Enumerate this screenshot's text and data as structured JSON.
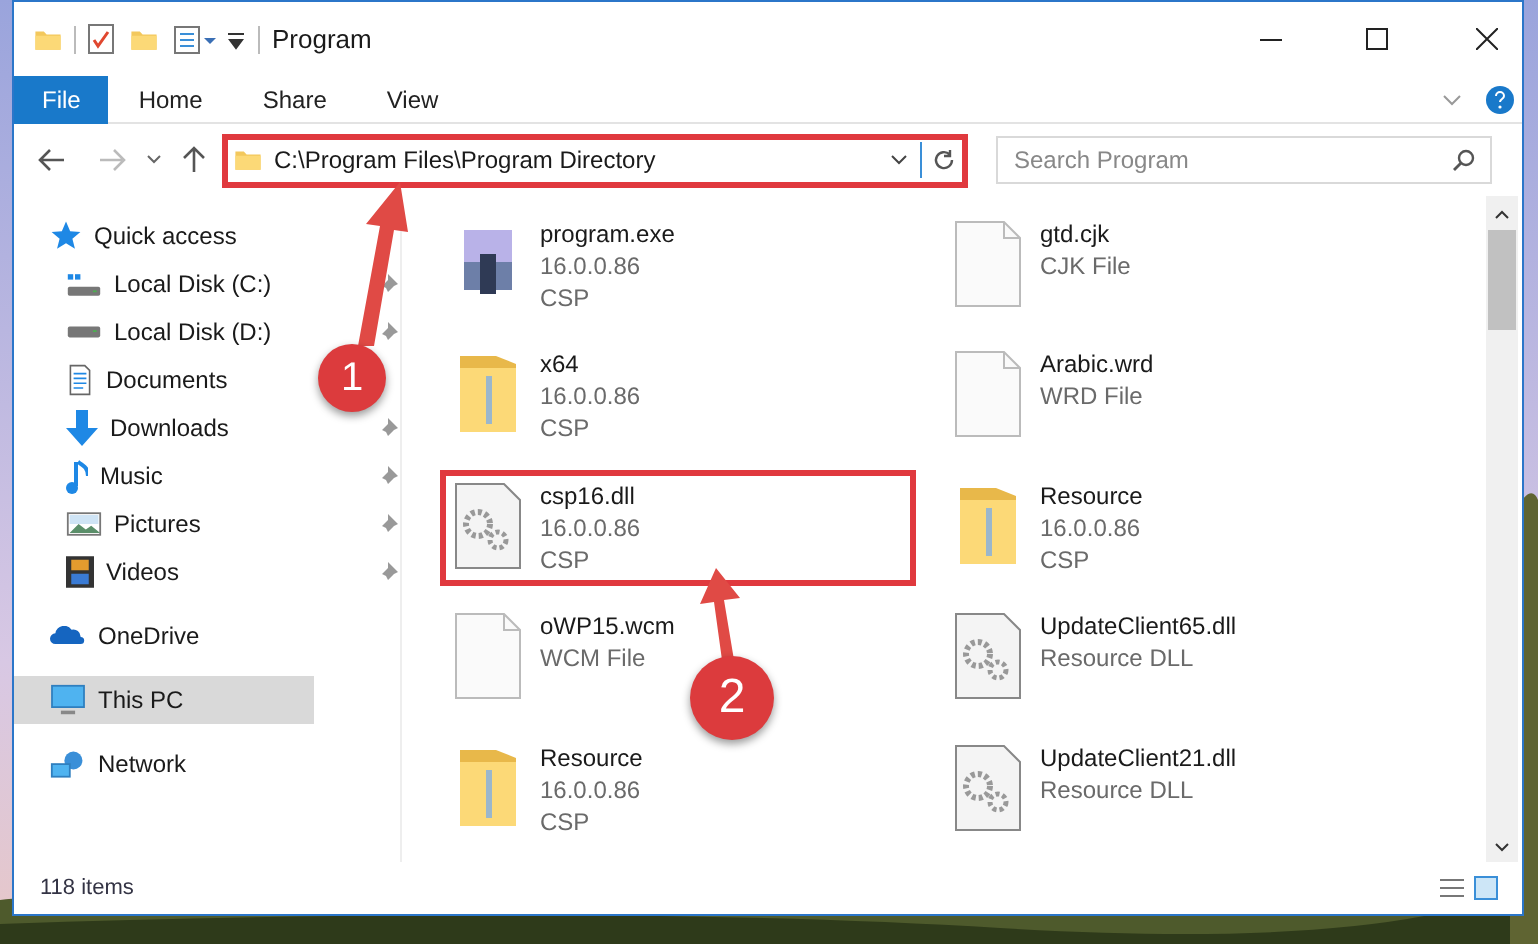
{
  "window": {
    "title": "Program"
  },
  "ribbon_tabs": [
    {
      "label": "File",
      "selected": true
    },
    {
      "label": "Home",
      "selected": false
    },
    {
      "label": "Share",
      "selected": false
    },
    {
      "label": "View",
      "selected": false
    }
  ],
  "address_bar": {
    "path": "C:\\Program Files\\Program Directory",
    "highlighted": true
  },
  "search": {
    "placeholder": "Search Program"
  },
  "sidebar": {
    "items": [
      {
        "label": "Quick access",
        "kind": "quick",
        "pinned": false,
        "selected": false
      },
      {
        "label": "Local Disk (C:)",
        "kind": "systemdrive",
        "pinned": true,
        "selected": false
      },
      {
        "label": "Local Disk (D:)",
        "kind": "drive",
        "pinned": true,
        "selected": false
      },
      {
        "label": "Documents",
        "kind": "documents",
        "pinned": false,
        "selected": false
      },
      {
        "label": "Downloads",
        "kind": "downloads",
        "pinned": true,
        "selected": false
      },
      {
        "label": "Music",
        "kind": "music",
        "pinned": true,
        "selected": false
      },
      {
        "label": "Pictures",
        "kind": "pictures",
        "pinned": true,
        "selected": false
      },
      {
        "label": "Videos",
        "kind": "videos",
        "pinned": true,
        "selected": false
      },
      {
        "label": "OneDrive",
        "kind": "cloud",
        "pinned": false,
        "selected": false
      },
      {
        "label": "This PC",
        "kind": "pc",
        "pinned": false,
        "selected": true
      },
      {
        "label": "Network",
        "kind": "network",
        "pinned": false,
        "selected": false
      }
    ]
  },
  "files": [
    {
      "kind": "exe",
      "lines": [
        "program.exe",
        "16.0.0.86",
        "CSP"
      ],
      "highlighted": false
    },
    {
      "kind": "folder",
      "lines": [
        "x64",
        "16.0.0.86",
        "CSP"
      ],
      "highlighted": false
    },
    {
      "kind": "dll",
      "lines": [
        "csp16.dll",
        "16.0.0.86",
        "CSP"
      ],
      "highlighted": true
    },
    {
      "kind": "doc",
      "lines": [
        "oWP15.wcm",
        "WCM File"
      ],
      "highlighted": false
    },
    {
      "kind": "folder",
      "lines": [
        "Resource",
        "16.0.0.86",
        "CSP"
      ],
      "highlighted": false
    },
    {
      "kind": "doc",
      "lines": [
        "gtd.cjk",
        "CJK File"
      ],
      "highlighted": false
    },
    {
      "kind": "doc",
      "lines": [
        "Arabic.wrd",
        "WRD File"
      ],
      "highlighted": false
    },
    {
      "kind": "folder",
      "lines": [
        "Resource",
        "16.0.0.86",
        "CSP"
      ],
      "highlighted": false
    },
    {
      "kind": "dll",
      "lines": [
        "UpdateClient65.dll",
        "Resource DLL"
      ],
      "highlighted": false
    },
    {
      "kind": "dll",
      "lines": [
        "UpdateClient21.dll",
        "Resource DLL"
      ],
      "highlighted": false
    }
  ],
  "status_bar": {
    "count": "118 items"
  },
  "annotations": [
    {
      "number": "1"
    },
    {
      "number": "2"
    }
  ]
}
